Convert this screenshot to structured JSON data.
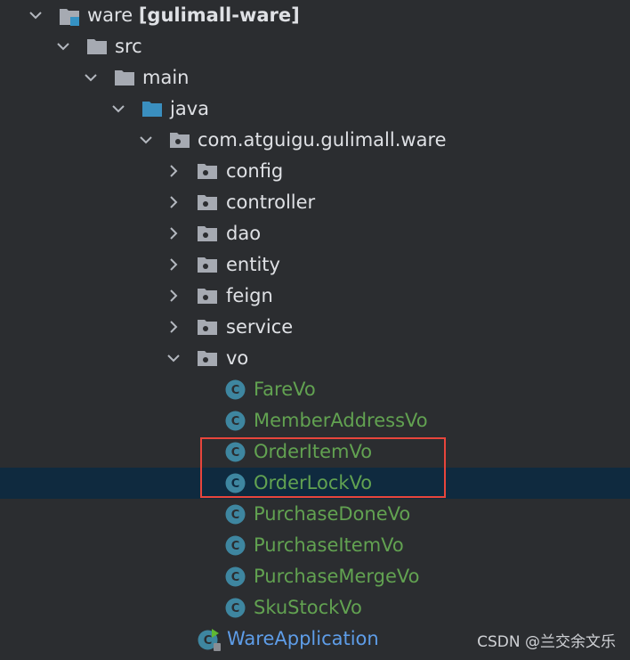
{
  "project_tree": {
    "root": {
      "name": "ware",
      "module": "[gulimall-ware]",
      "expanded": true
    },
    "src": {
      "label": "src",
      "expanded": true
    },
    "main": {
      "label": "main",
      "expanded": true
    },
    "java": {
      "label": "java",
      "expanded": true
    },
    "package": {
      "label": "com.atguigu.gulimall.ware",
      "expanded": true
    },
    "subpackages": [
      {
        "label": "config",
        "expanded": false
      },
      {
        "label": "controller",
        "expanded": false
      },
      {
        "label": "dao",
        "expanded": false
      },
      {
        "label": "entity",
        "expanded": false
      },
      {
        "label": "feign",
        "expanded": false
      },
      {
        "label": "service",
        "expanded": false
      },
      {
        "label": "vo",
        "expanded": true
      }
    ],
    "vo_classes": [
      {
        "label": "FareVo"
      },
      {
        "label": "MemberAddressVo"
      },
      {
        "label": "OrderItemVo",
        "highlighted": true
      },
      {
        "label": "OrderLockVo",
        "highlighted": true,
        "selected": true
      },
      {
        "label": "PurchaseDoneVo"
      },
      {
        "label": "PurchaseItemVo"
      },
      {
        "label": "PurchaseMergeVo"
      },
      {
        "label": "SkuStockVo"
      }
    ],
    "application_class": {
      "label": "WareApplication"
    }
  },
  "watermark": "CSDN @兰交余文乐",
  "colors": {
    "background": "#2b2d30",
    "selection": "#0f2a3f",
    "text": "#dfe1e5",
    "class_text": "#62a251",
    "app_text": "#5e9de8",
    "folder": "#a6aab2",
    "class_badge": "#3e86a0",
    "highlight_border": "#e8453c"
  }
}
